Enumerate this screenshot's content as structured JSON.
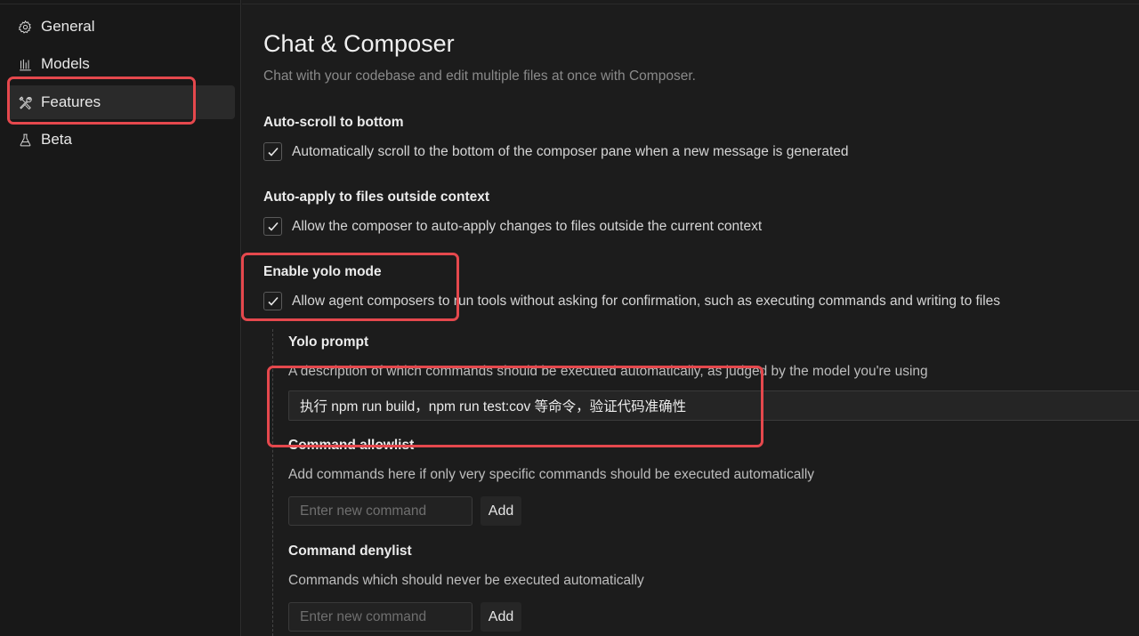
{
  "sidebar": {
    "items": [
      {
        "label": "General",
        "icon": "gear-icon"
      },
      {
        "label": "Models",
        "icon": "bar-chart-icon"
      },
      {
        "label": "Features",
        "icon": "tools-icon",
        "active": true
      },
      {
        "label": "Beta",
        "icon": "flask-icon"
      }
    ]
  },
  "page": {
    "title": "Chat & Composer",
    "subtitle": "Chat with your codebase and edit multiple files at once with Composer."
  },
  "settings": {
    "auto_scroll": {
      "title": "Auto-scroll to bottom",
      "label": "Automatically scroll to the bottom of the composer pane when a new message is generated",
      "checked": true
    },
    "auto_apply": {
      "title": "Auto-apply to files outside context",
      "label": "Allow the composer to auto-apply changes to files outside the current context",
      "checked": true
    },
    "yolo_mode": {
      "title": "Enable yolo mode",
      "label": "Allow agent composers to run tools without asking for confirmation, such as executing commands and writing to files",
      "checked": true
    }
  },
  "yolo": {
    "prompt_title": "Yolo prompt",
    "prompt_desc": "A description of which commands should be executed automatically, as judged by the model you're using",
    "prompt_value": "执行 npm run build，npm run test:cov 等命令，验证代码准确性",
    "allowlist_title": "Command allowlist",
    "allowlist_desc": "Add commands here if only very specific commands should be executed automatically",
    "allowlist_placeholder": "Enter new command",
    "allowlist_add": "Add",
    "denylist_title": "Command denylist",
    "denylist_desc": "Commands which should never be executed automatically",
    "denylist_placeholder": "Enter new command",
    "denylist_add": "Add"
  },
  "colors": {
    "highlight": "#e5484d",
    "background": "#1c1c1c",
    "sidebar_bg": "#181818"
  }
}
